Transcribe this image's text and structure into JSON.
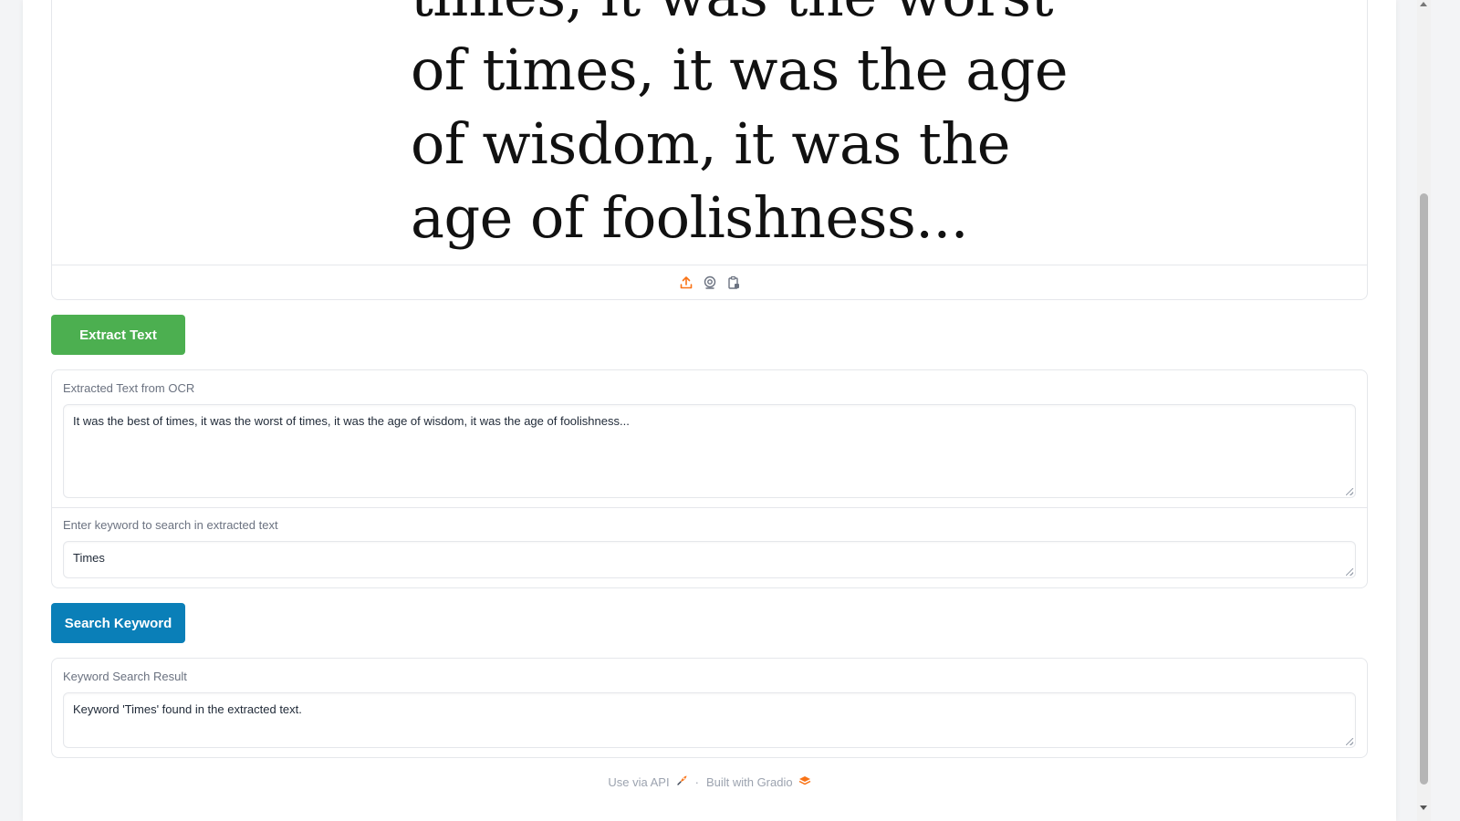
{
  "image_panel": {
    "text_lines": [
      "times, it was the worst",
      "of times, it was the age",
      "of wisdom, it was the",
      "age of foolishness..."
    ],
    "toolbar_icons": [
      "upload-icon",
      "webcam-icon",
      "clipboard-icon"
    ]
  },
  "buttons": {
    "extract": "Extract Text",
    "search": "Search Keyword"
  },
  "ocr_output": {
    "label": "Extracted Text from OCR",
    "value": "It was the best of times, it was the worst of times, it was the age of wisdom, it was the age of foolishness..."
  },
  "keyword_input": {
    "label": "Enter keyword to search in extracted text",
    "value": "Times"
  },
  "result": {
    "label": "Keyword Search Result",
    "value": "Keyword 'Times' found in the extracted text."
  },
  "footer": {
    "api_link": "Use via API",
    "separator": "·",
    "built_with": "Built with Gradio"
  },
  "colors": {
    "extract_button": "#4caf50",
    "search_button": "#0a7fb8",
    "accent_orange": "#f97316"
  }
}
